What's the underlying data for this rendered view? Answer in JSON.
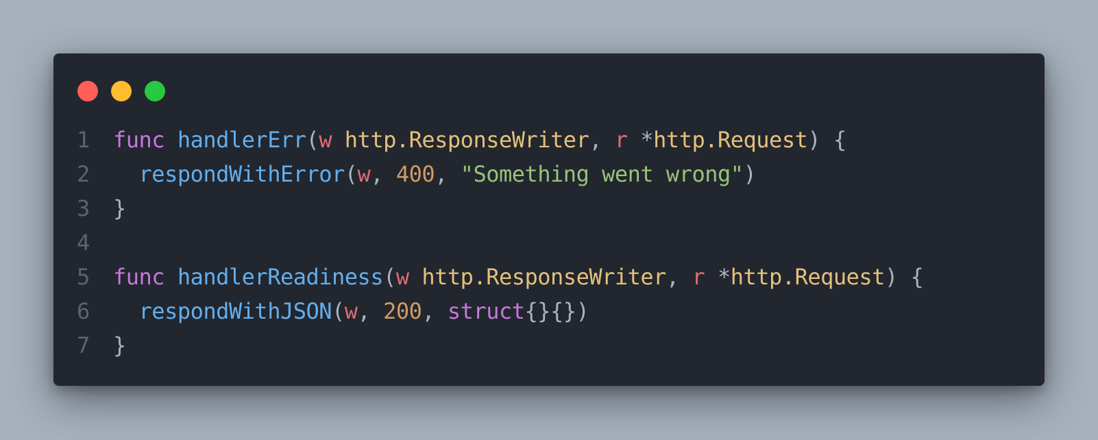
{
  "colors": {
    "background": "#a6b1bd",
    "window": "#22262e",
    "close": "#ff5f57",
    "minimize": "#febc2e",
    "maximize": "#28c840",
    "keyword": "#c678dd",
    "function": "#61afef",
    "param": "#e06c75",
    "type": "#e5c07b",
    "number": "#d19a66",
    "string": "#98c379",
    "plain": "#abb2bf",
    "line_number": "#5c6370"
  },
  "window_controls": [
    "close-dot",
    "minimize-dot",
    "maximize-dot"
  ],
  "code": {
    "lines": [
      {
        "number": "1",
        "tokens": [
          {
            "text": "func",
            "kind": "keyword"
          },
          {
            "text": " ",
            "kind": "plain"
          },
          {
            "text": "handlerErr",
            "kind": "function"
          },
          {
            "text": "(",
            "kind": "plain"
          },
          {
            "text": "w",
            "kind": "param"
          },
          {
            "text": " ",
            "kind": "plain"
          },
          {
            "text": "http.ResponseWriter",
            "kind": "type"
          },
          {
            "text": ", ",
            "kind": "plain"
          },
          {
            "text": "r",
            "kind": "param"
          },
          {
            "text": " *",
            "kind": "plain"
          },
          {
            "text": "http.Request",
            "kind": "type"
          },
          {
            "text": ") {",
            "kind": "plain"
          }
        ]
      },
      {
        "number": "2",
        "tokens": [
          {
            "text": "  ",
            "kind": "plain"
          },
          {
            "text": "respondWithError",
            "kind": "function"
          },
          {
            "text": "(",
            "kind": "plain"
          },
          {
            "text": "w",
            "kind": "param"
          },
          {
            "text": ", ",
            "kind": "plain"
          },
          {
            "text": "400",
            "kind": "number"
          },
          {
            "text": ", ",
            "kind": "plain"
          },
          {
            "text": "\"Something went wrong\"",
            "kind": "string"
          },
          {
            "text": ")",
            "kind": "plain"
          }
        ]
      },
      {
        "number": "3",
        "tokens": [
          {
            "text": "}",
            "kind": "plain"
          }
        ]
      },
      {
        "number": "4",
        "tokens": []
      },
      {
        "number": "5",
        "tokens": [
          {
            "text": "func",
            "kind": "keyword"
          },
          {
            "text": " ",
            "kind": "plain"
          },
          {
            "text": "handlerReadiness",
            "kind": "function"
          },
          {
            "text": "(",
            "kind": "plain"
          },
          {
            "text": "w",
            "kind": "param"
          },
          {
            "text": " ",
            "kind": "plain"
          },
          {
            "text": "http.ResponseWriter",
            "kind": "type"
          },
          {
            "text": ", ",
            "kind": "plain"
          },
          {
            "text": "r",
            "kind": "param"
          },
          {
            "text": " *",
            "kind": "plain"
          },
          {
            "text": "http.Request",
            "kind": "type"
          },
          {
            "text": ") {",
            "kind": "plain"
          }
        ]
      },
      {
        "number": "6",
        "tokens": [
          {
            "text": "  ",
            "kind": "plain"
          },
          {
            "text": "respondWithJSON",
            "kind": "function"
          },
          {
            "text": "(",
            "kind": "plain"
          },
          {
            "text": "w",
            "kind": "param"
          },
          {
            "text": ", ",
            "kind": "plain"
          },
          {
            "text": "200",
            "kind": "number"
          },
          {
            "text": ", ",
            "kind": "plain"
          },
          {
            "text": "struct",
            "kind": "keyword"
          },
          {
            "text": "{}{})",
            "kind": "plain"
          }
        ]
      },
      {
        "number": "7",
        "tokens": [
          {
            "text": "}",
            "kind": "plain"
          }
        ]
      }
    ]
  }
}
